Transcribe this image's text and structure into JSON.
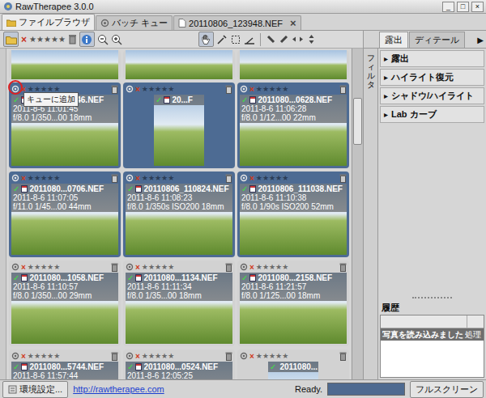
{
  "window": {
    "title": "RawTherapee 3.0.0",
    "controls": [
      "_",
      "□",
      "×"
    ]
  },
  "tabs": [
    {
      "label": "ファイルブラウザ",
      "selected": true,
      "closable": false,
      "kind": "browser"
    },
    {
      "label": "バッチ キュー",
      "selected": false,
      "closable": false,
      "kind": "queue"
    },
    {
      "label": "20110806_123948.NEF",
      "selected": false,
      "closable": true,
      "kind": "editor"
    }
  ],
  "tab_close": "×",
  "toolbar": {
    "reject": "×",
    "star": "★",
    "stars": 0,
    "folder_on": true,
    "info_on": true,
    "hand_on": true
  },
  "thumb_symbols": {
    "reject": "×",
    "star": "★",
    "check": "✓"
  },
  "top_row": [
    {
      "selected": false
    },
    {
      "selected": false
    },
    {
      "selected": false
    }
  ],
  "thumbnails": [
    {
      "file": "2011080...0146.NEF",
      "date": "2011-8-6 11:01:45",
      "exif": "f/8.0 1/350...00 18mm",
      "kind": "landscape",
      "selected": true,
      "checked": true,
      "stars": 0,
      "highlighted": true,
      "tooltip": true
    },
    {
      "file": "20...F",
      "date": "",
      "exif": "",
      "kind": "portrait",
      "selected": true,
      "checked": true,
      "stars": 0,
      "highlighted": false,
      "tooltip": false
    },
    {
      "file": "2011080...0628.NEF",
      "date": "2011-8-6 11:06:28",
      "exif": "f/8.0 1/12...00 22mm",
      "kind": "landscape",
      "selected": true,
      "checked": true,
      "stars": 0,
      "highlighted": false,
      "tooltip": false
    },
    {
      "file": "2011080...0706.NEF",
      "date": "2011-8-6 11:07:05",
      "exif": "f/11.0 1/45...00 44mm",
      "kind": "landscape",
      "selected": true,
      "checked": true,
      "stars": 0,
      "highlighted": false,
      "tooltip": false
    },
    {
      "file": "20110806_110824.NEF",
      "date": "2011-8-6 11:08:23",
      "exif": "f/8.0 1/350s ISO200 18mm",
      "kind": "landscape",
      "selected": true,
      "checked": true,
      "stars": 0,
      "highlighted": false,
      "tooltip": false
    },
    {
      "file": "20110806_111038.NEF",
      "date": "2011-8-6 11:10:38",
      "exif": "f/8.0 1/90s ISO200 52mm",
      "kind": "landscape",
      "selected": true,
      "checked": true,
      "stars": 0,
      "highlighted": false,
      "tooltip": false
    },
    {
      "file": "2011080...1058.NEF",
      "date": "2011-8-6 11:10:57",
      "exif": "f/8.0 1/350...00 29mm",
      "kind": "landscape",
      "selected": false,
      "checked": true,
      "stars": 0,
      "highlighted": false,
      "tooltip": false
    },
    {
      "file": "2011080...1134.NEF",
      "date": "2011-8-6 11:11:34",
      "exif": "f/8.0 1/35...00 18mm",
      "kind": "landscape",
      "selected": false,
      "checked": true,
      "stars": 0,
      "highlighted": false,
      "tooltip": false
    },
    {
      "file": "2011080...2158.NEF",
      "date": "2011-8-6 11:21:57",
      "exif": "f/8.0 1/125...00 18mm",
      "kind": "landscape",
      "selected": false,
      "checked": true,
      "stars": 0,
      "highlighted": false,
      "tooltip": false
    },
    {
      "file": "2011080...5744.NEF",
      "date": "2011-8-6 11:57:44",
      "exif": "",
      "kind": "landscape",
      "selected": false,
      "checked": true,
      "stars": 0,
      "highlighted": false,
      "tooltip": false
    },
    {
      "file": "2011080...0524.NEF",
      "date": "2011-8-6 12:05:25",
      "exif": "",
      "kind": "landscape",
      "selected": false,
      "checked": true,
      "stars": 0,
      "highlighted": false,
      "tooltip": false
    },
    {
      "file": "2011080...",
      "date": "",
      "exif": "",
      "kind": "portrait",
      "selected": false,
      "checked": true,
      "stars": 0,
      "highlighted": false,
      "tooltip": false
    }
  ],
  "scrollbar": {
    "position": 0.15,
    "size": 0.14
  },
  "tooltip": "キューに追加",
  "right_panel": {
    "tabs": [
      {
        "label": "露出",
        "selected": true
      },
      {
        "label": "ディテール",
        "selected": false
      }
    ],
    "next": "▶",
    "side_tab": "フィルタ",
    "expander": "▸",
    "sections": [
      {
        "label": "露出",
        "expanded": false
      },
      {
        "label": "ハイライト復元",
        "expanded": false
      },
      {
        "label": "シャドウ/ハイライト",
        "expanded": false
      },
      {
        "label": "Lab カーブ",
        "expanded": false
      }
    ]
  },
  "history": {
    "title": "履歴",
    "rows": [
      {
        "label": "写真を読み込みました",
        "extra": "処理",
        "selected": true
      }
    ]
  },
  "status_bar": {
    "preferences": "環境設定...",
    "link": "http://rawtherapee.com",
    "status": "Ready.",
    "progress": 0,
    "fullscreen": "フルスクリーン"
  }
}
